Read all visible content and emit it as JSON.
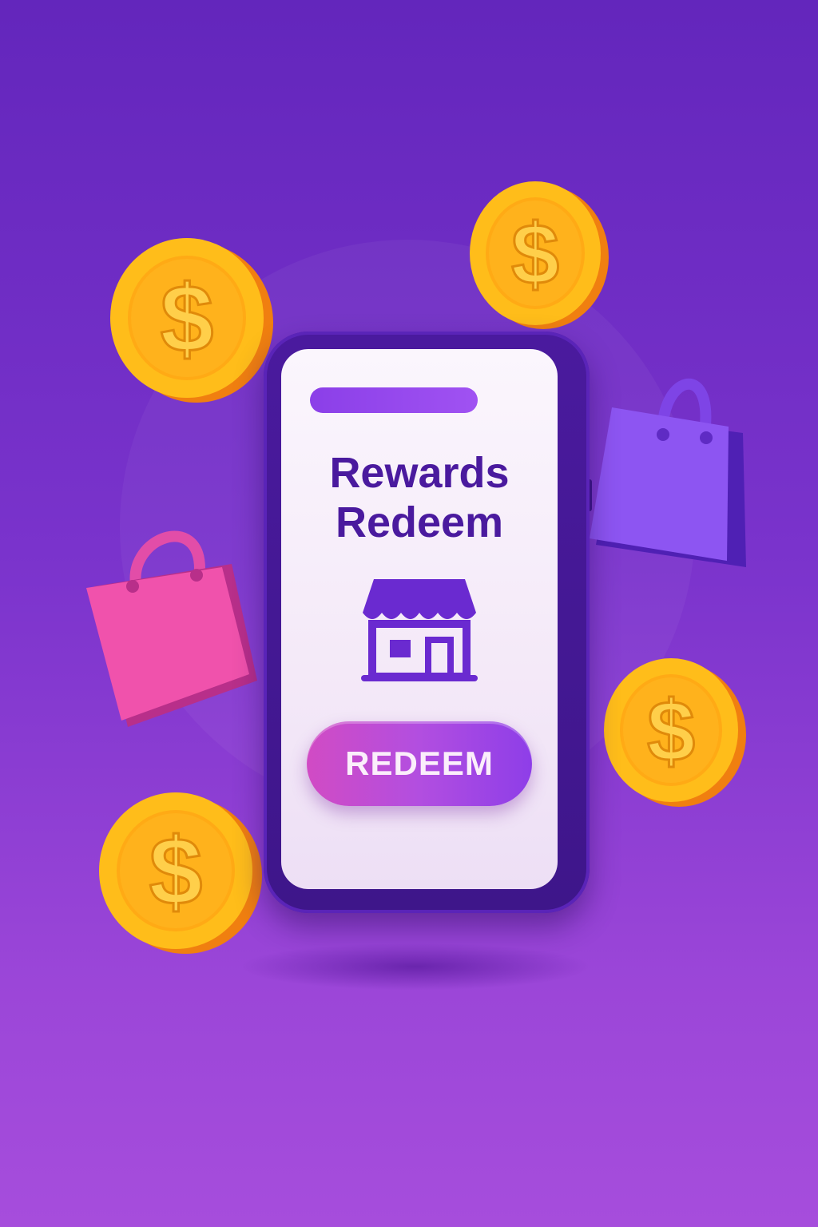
{
  "screen": {
    "title_line1": "Rewards",
    "title_line2": "Redeem",
    "redeem_label": "REDEEM"
  },
  "icons": {
    "store": "store-icon",
    "coin": "dollar-coin-icon",
    "bag": "shopping-bag-icon"
  },
  "colors": {
    "background": "#7a33cc",
    "phone_frame": "#4a1a9e",
    "accent": "#8b3fe8",
    "button_start": "#d14bc4",
    "button_end": "#8e3ee8",
    "coin": "#ffb81c",
    "bag_pink": "#ee4aa8",
    "bag_purple": "#8a4ff0"
  }
}
